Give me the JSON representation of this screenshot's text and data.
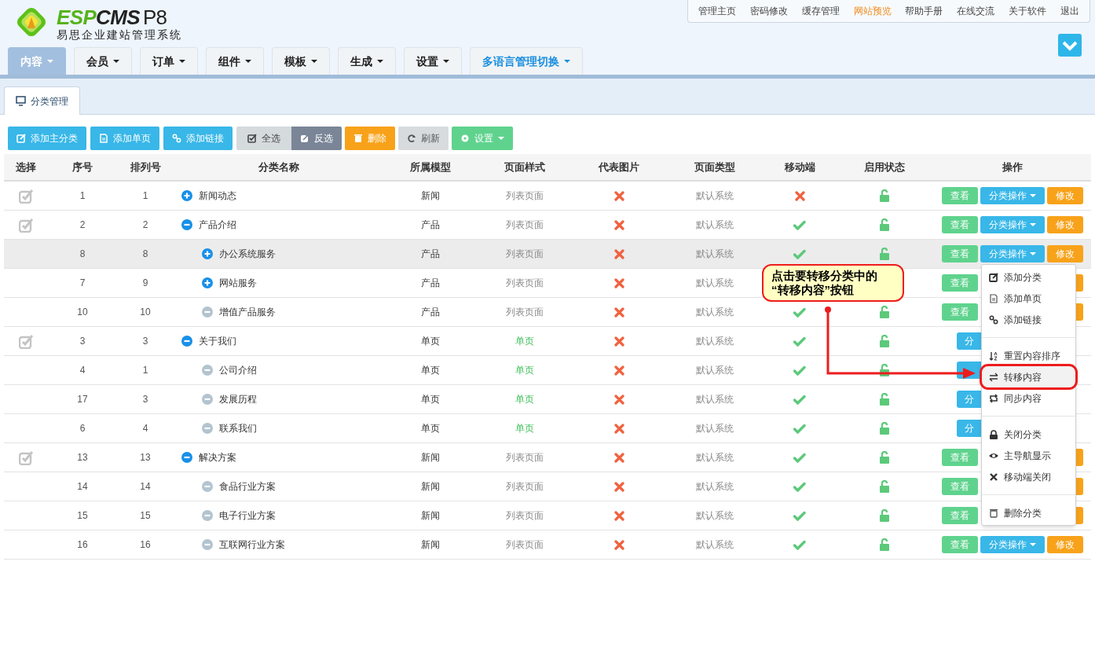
{
  "logo": {
    "brand_a": "ESP",
    "brand_b": "CMS",
    "version": "P8",
    "subtitle": "易思企业建站管理系统"
  },
  "top_links": [
    {
      "label": "管理主页",
      "active": false
    },
    {
      "label": "密码修改",
      "active": false
    },
    {
      "label": "缓存管理",
      "active": false
    },
    {
      "label": "网站预览",
      "active": true
    },
    {
      "label": "帮助手册",
      "active": false
    },
    {
      "label": "在线交流",
      "active": false
    },
    {
      "label": "关于软件",
      "active": false
    },
    {
      "label": "退出",
      "active": false
    }
  ],
  "main_tabs": [
    {
      "label": "内容",
      "selected": true,
      "kind": "menu"
    },
    {
      "label": "会员",
      "selected": false,
      "kind": "menu"
    },
    {
      "label": "订单",
      "selected": false,
      "kind": "menu"
    },
    {
      "label": "组件",
      "selected": false,
      "kind": "menu"
    },
    {
      "label": "模板",
      "selected": false,
      "kind": "menu"
    },
    {
      "label": "生成",
      "selected": false,
      "kind": "menu"
    },
    {
      "label": "设置",
      "selected": false,
      "kind": "menu"
    },
    {
      "label": "多语言管理切换",
      "selected": false,
      "kind": "language"
    }
  ],
  "sub_tabs": [
    {
      "label": "分类管理",
      "selected": true
    }
  ],
  "toolbar": [
    {
      "label": "添加主分类",
      "kind": "add"
    },
    {
      "label": "添加单页",
      "kind": "add"
    },
    {
      "label": "添加链接",
      "kind": "add"
    },
    {
      "label": "全选",
      "kind": "select"
    },
    {
      "label": "反选",
      "kind": "invert"
    },
    {
      "label": "删除",
      "kind": "delete"
    },
    {
      "label": "刷新",
      "kind": "refresh"
    },
    {
      "label": "设置",
      "kind": "settings"
    }
  ],
  "table": {
    "columns": [
      "选择",
      "序号",
      "排列号",
      "分类名称",
      "所属模型",
      "页面样式",
      "代表图片",
      "页面类型",
      "移动端",
      "启用状态",
      "操作"
    ],
    "rows": [
      {
        "id": "1",
        "sort": "1",
        "name": "新闻动态",
        "expanded": false,
        "leaf": false,
        "model": "新闻",
        "style": "列表页面",
        "kind": "list",
        "image": false,
        "page_type": "默认系统",
        "mobile": false,
        "enabled": true,
        "hovered": false,
        "actions": [
          {
            "kind": "view",
            "label": "查看"
          },
          {
            "kind": "ops",
            "label": "分类操作"
          },
          {
            "kind": "edit",
            "label": "修改"
          }
        ]
      },
      {
        "id": "2",
        "sort": "2",
        "name": "产品介绍",
        "expanded": true,
        "leaf": false,
        "model": "产品",
        "style": "列表页面",
        "kind": "list",
        "image": false,
        "page_type": "默认系统",
        "mobile": true,
        "enabled": true,
        "hovered": false,
        "actions": [
          {
            "kind": "view",
            "label": "查看"
          },
          {
            "kind": "ops",
            "label": "分类操作"
          },
          {
            "kind": "edit",
            "label": "修改"
          }
        ],
        "children": [
          {
            "id": "8",
            "sort": "8",
            "name": "办公系统服务",
            "expanded": false,
            "leaf": false,
            "model": "产品",
            "style": "列表页面",
            "kind": "list",
            "image": false,
            "page_type": "默认系统",
            "mobile": true,
            "enabled": true,
            "hovered": true,
            "actions": [
              {
                "kind": "view",
                "label": "查看"
              },
              {
                "kind": "ops",
                "label": "分类操作"
              },
              {
                "kind": "edit",
                "label": "修改"
              }
            ]
          },
          {
            "id": "7",
            "sort": "9",
            "name": "网站服务",
            "expanded": false,
            "leaf": false,
            "model": "产品",
            "style": "列表页面",
            "kind": "list",
            "image": false,
            "page_type": "默认系统",
            "hovered": false,
            "actions": [
              {
                "kind": "view",
                "label": "查看"
              },
              {
                "kind": "edit"
              }
            ]
          },
          {
            "id": "10",
            "sort": "10",
            "name": "增值产品服务",
            "leaf": true,
            "model": "产品",
            "style": "列表页面",
            "kind": "list",
            "image": false,
            "page_type": "默认系统",
            "mobile": true,
            "enabled": true,
            "hovered": false,
            "actions": [
              {
                "kind": "view",
                "label": "查看"
              },
              {
                "kind": "edit"
              }
            ]
          }
        ]
      },
      {
        "id": "3",
        "sort": "3",
        "name": "关于我们",
        "expanded": true,
        "leaf": false,
        "model": "单页",
        "style": "单页",
        "kind": "single",
        "image": false,
        "page_type": "默认系统",
        "mobile": true,
        "enabled": true,
        "hovered": false,
        "actions": [
          {
            "kind": "ops_single",
            "label": "分"
          }
        ],
        "children": [
          {
            "id": "4",
            "sort": "1",
            "name": "公司介绍",
            "leaf": true,
            "model": "单页",
            "style": "单页",
            "kind": "single",
            "image": false,
            "page_type": "默认系统",
            "mobile": true,
            "enabled": true,
            "hovered": false,
            "actions": [
              {
                "kind": "ops_single"
              }
            ]
          },
          {
            "id": "17",
            "sort": "3",
            "name": "发展历程",
            "leaf": true,
            "model": "单页",
            "style": "单页",
            "kind": "single",
            "image": false,
            "page_type": "默认系统",
            "mobile": true,
            "enabled": true,
            "hovered": false,
            "actions": [
              {
                "kind": "ops_single",
                "label": "分"
              }
            ]
          },
          {
            "id": "6",
            "sort": "4",
            "name": "联系我们",
            "leaf": true,
            "model": "单页",
            "style": "单页",
            "kind": "single",
            "image": false,
            "page_type": "默认系统",
            "mobile": true,
            "enabled": true,
            "hovered": false,
            "actions": [
              {
                "kind": "ops_single",
                "label": "分"
              }
            ]
          }
        ]
      },
      {
        "id": "13",
        "sort": "13",
        "name": "解决方案",
        "expanded": true,
        "leaf": false,
        "model": "新闻",
        "style": "列表页面",
        "kind": "list",
        "image": false,
        "page_type": "默认系统",
        "mobile": true,
        "enabled": true,
        "hovered": false,
        "actions": [
          {
            "kind": "view",
            "label": "查看"
          },
          {
            "kind": "edit"
          }
        ],
        "children": [
          {
            "id": "14",
            "sort": "14",
            "name": "食品行业方案",
            "leaf": true,
            "model": "新闻",
            "style": "列表页面",
            "kind": "list",
            "image": false,
            "page_type": "默认系统",
            "mobile": true,
            "enabled": true,
            "hovered": false,
            "actions": [
              {
                "kind": "view",
                "label": "查看"
              },
              {
                "kind": "edit"
              }
            ]
          },
          {
            "id": "15",
            "sort": "15",
            "name": "电子行业方案",
            "leaf": true,
            "model": "新闻",
            "style": "列表页面",
            "kind": "list",
            "image": false,
            "page_type": "默认系统",
            "mobile": true,
            "enabled": true,
            "hovered": false,
            "actions": [
              {
                "kind": "view",
                "label": "查看"
              },
              {
                "kind": "edit"
              }
            ]
          },
          {
            "id": "16",
            "sort": "16",
            "name": "互联网行业方案",
            "leaf": true,
            "model": "新闻",
            "style": "列表页面",
            "kind": "list",
            "image": false,
            "page_type": "默认系统",
            "mobile": true,
            "enabled": true,
            "hovered": false,
            "actions": [
              {
                "kind": "view",
                "label": "查看"
              },
              {
                "kind": "ops",
                "label": "分类操作"
              },
              {
                "kind": "edit",
                "label": "修改"
              }
            ]
          }
        ]
      }
    ]
  },
  "dropdown": {
    "groups": [
      [
        {
          "label": "添加分类",
          "highlighted": false
        },
        {
          "label": "添加单页",
          "highlighted": false
        },
        {
          "label": "添加链接",
          "highlighted": false
        }
      ],
      [
        {
          "label": "重置内容排序",
          "highlighted": false
        },
        {
          "label": "转移内容",
          "highlighted": true
        },
        {
          "label": "同步内容",
          "highlighted": false
        }
      ],
      [
        {
          "label": "关闭分类",
          "highlighted": false
        },
        {
          "label": "主导航显示",
          "highlighted": false
        },
        {
          "label": "移动端关闭",
          "highlighted": false
        }
      ],
      [
        {
          "label": "删除分类",
          "highlighted": false
        }
      ]
    ]
  },
  "callout": {
    "lines": [
      "点击要转移分类中的",
      "“转移内容”按钮"
    ]
  }
}
